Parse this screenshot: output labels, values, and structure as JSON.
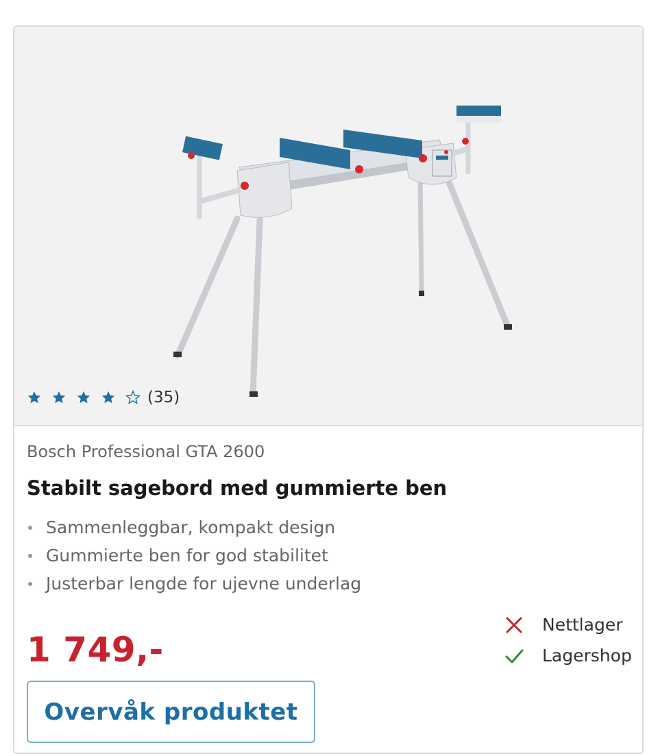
{
  "product": {
    "brand": "Bosch Professional GTA 2600",
    "title": "Stabilt sagebord med gummierte ben",
    "features": [
      "Sammenleggbar, kompakt design",
      "Gummierte ben for god stabilitet",
      "Justerbar lengde for ujevne underlag"
    ],
    "price": "1 749,-",
    "rating": {
      "value": 4,
      "max": 5,
      "count_label": "(35)"
    },
    "image_icon": "miter-saw-stand-image"
  },
  "availability": [
    {
      "label": "Nettlager",
      "available": false,
      "icon": "cross-icon",
      "color": "#c8232c"
    },
    {
      "label": "Lagershop",
      "available": true,
      "icon": "check-icon",
      "color": "#2e8b3e"
    }
  ],
  "actions": {
    "watch_label": "Overvåk produktet"
  },
  "colors": {
    "accent": "#1d6fa5",
    "price": "#c8232c",
    "star": "#1d6fa5"
  }
}
